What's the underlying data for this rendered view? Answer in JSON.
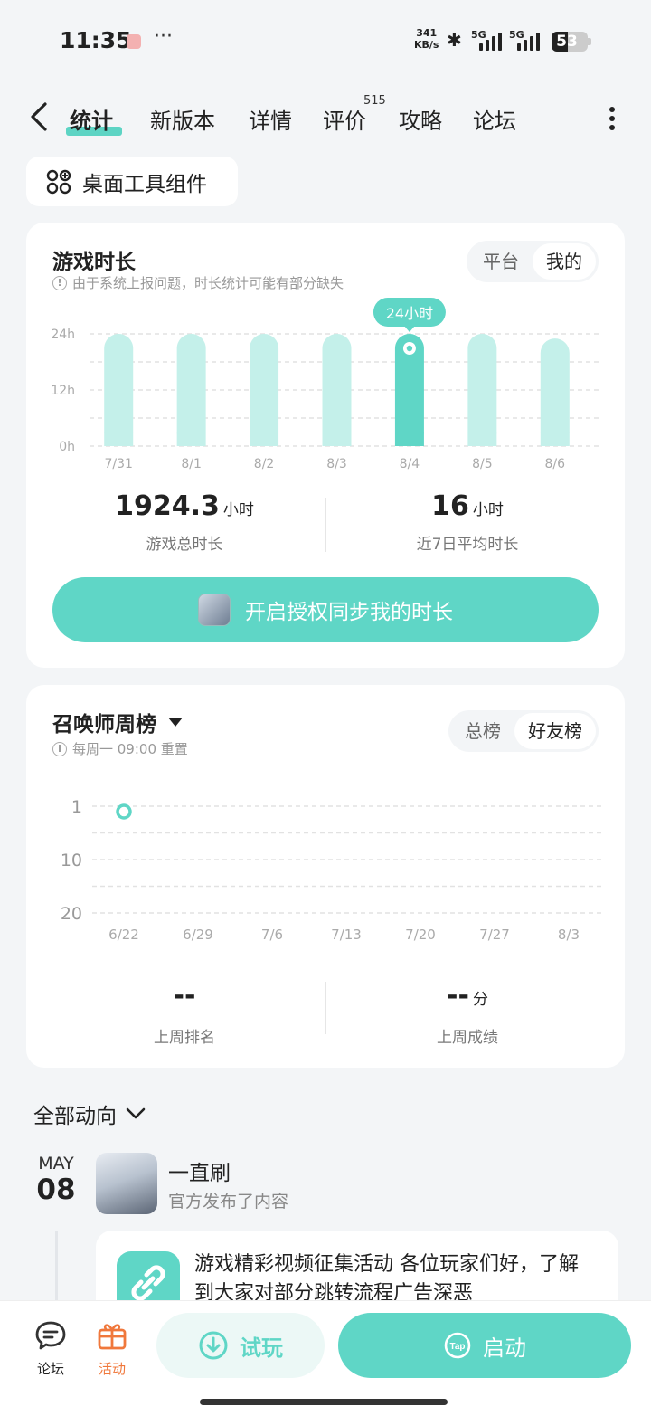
{
  "status_bar": {
    "time": "11:35",
    "more": "···",
    "speed_value": "341",
    "speed_unit": "KB/s",
    "sig1": "5G",
    "sig2": "5G",
    "battery": "53"
  },
  "nav": {
    "tabs": [
      {
        "label": "统计",
        "active": true
      },
      {
        "label": "新版本"
      },
      {
        "label": "详情"
      },
      {
        "label": "评价"
      },
      {
        "label": "攻略"
      },
      {
        "label": "论坛"
      }
    ],
    "review_count": "515"
  },
  "widget_button": "桌面工具组件",
  "playtime": {
    "title": "游戏时长",
    "note": "由于系统上报问题，时长统计可能有部分缺失",
    "toggle": [
      "平台",
      "我的"
    ],
    "toggle_selected": "我的",
    "tooltip": "24小时",
    "total_value": "1924.3",
    "total_unit": "小时",
    "total_label": "游戏总时长",
    "avg_value": "16",
    "avg_unit": "小时",
    "avg_label": "近7日平均时长",
    "sync_button": "开启授权同步我的时长"
  },
  "ranking": {
    "title": "召唤师周榜",
    "note": "每周一 09:00 重置",
    "toggle": [
      "总榜",
      "好友榜"
    ],
    "toggle_selected": "好友榜",
    "last_rank_value": "--",
    "last_rank_label": "上周排名",
    "last_score_value": "--",
    "last_score_unit": "分",
    "last_score_label": "上周成绩"
  },
  "feed": {
    "filter": "全部动向",
    "month": "MAY",
    "day": "08",
    "author": "一直刷",
    "action": "官方发布了内容",
    "post_text": "游戏精彩视频征集活动 各位玩家们好，了解到大家对部分跳转流程广告深恶"
  },
  "bottom_bar": {
    "forum": "论坛",
    "activity": "活动",
    "try": "试玩",
    "launch": "启动",
    "tap_logo": "Tap"
  },
  "colors": {
    "accent": "#5fd6c6",
    "accent_light": "#c4f0ea",
    "activity": "#f0783c"
  },
  "chart_data": [
    {
      "type": "bar",
      "title": "游戏时长",
      "categories": [
        "7/31",
        "8/1",
        "8/2",
        "8/3",
        "8/4",
        "8/5",
        "8/6"
      ],
      "values": [
        24,
        24,
        24,
        24,
        24,
        24,
        23
      ],
      "highlighted": "8/4",
      "yticks": [
        "24h",
        "12h",
        "0h"
      ],
      "ylim": [
        0,
        24
      ]
    },
    {
      "type": "line",
      "title": "召唤师周榜",
      "categories": [
        "6/22",
        "6/29",
        "7/6",
        "7/13",
        "7/20",
        "7/27",
        "8/3"
      ],
      "values": [
        1,
        null,
        null,
        null,
        null,
        null,
        null
      ],
      "yticks": [
        "1",
        "10",
        "20"
      ],
      "inverted": true
    }
  ]
}
